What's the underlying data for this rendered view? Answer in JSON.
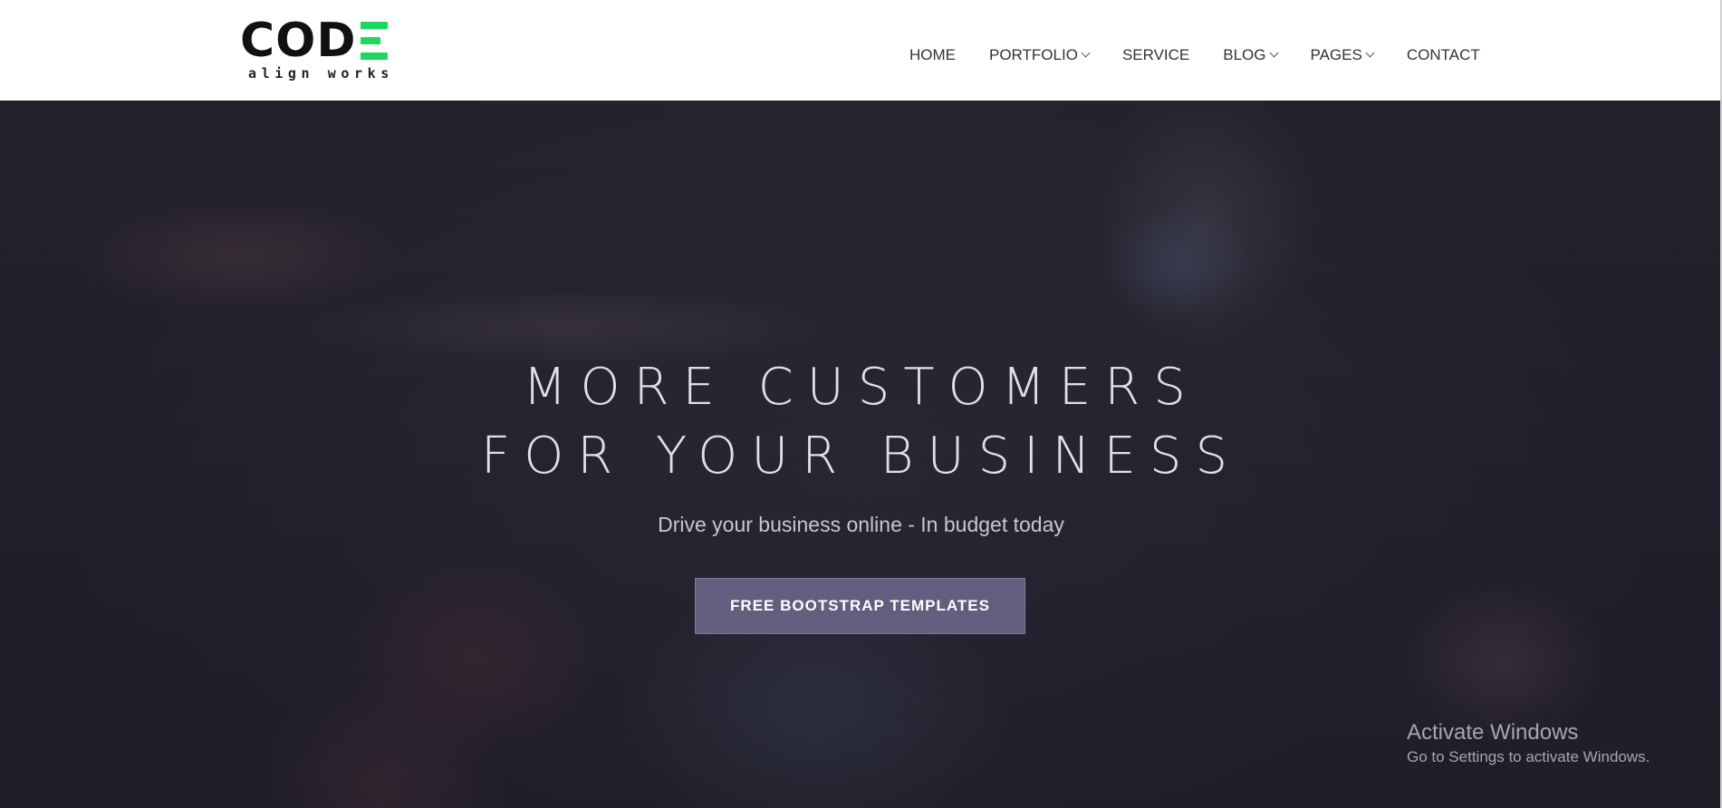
{
  "logo": {
    "main": "COD",
    "accent_letter": "E",
    "tagline": "align works",
    "accent_color": "#1ed760"
  },
  "nav": {
    "items": [
      {
        "label": "HOME",
        "has_dropdown": false
      },
      {
        "label": "PORTFOLIO",
        "has_dropdown": true,
        "icon": "chevron-down-icon"
      },
      {
        "label": "SERVICE",
        "has_dropdown": false
      },
      {
        "label": "BLOG",
        "has_dropdown": true,
        "icon": "chevron-down-icon"
      },
      {
        "label": "PAGES",
        "has_dropdown": true,
        "icon": "chevron-down-icon"
      },
      {
        "label": "CONTACT",
        "has_dropdown": false
      }
    ]
  },
  "hero": {
    "title_line1": "MORE CUSTOMERS",
    "title_line2": "FOR YOUR BUSINESS",
    "subtitle": "Drive your business online - In budget today",
    "button_label": "FREE BOOTSTRAP TEMPLATES",
    "button_color": "#655d7d"
  },
  "watermark": {
    "title": "Activate Windows",
    "subtitle": "Go to Settings to activate Windows."
  }
}
